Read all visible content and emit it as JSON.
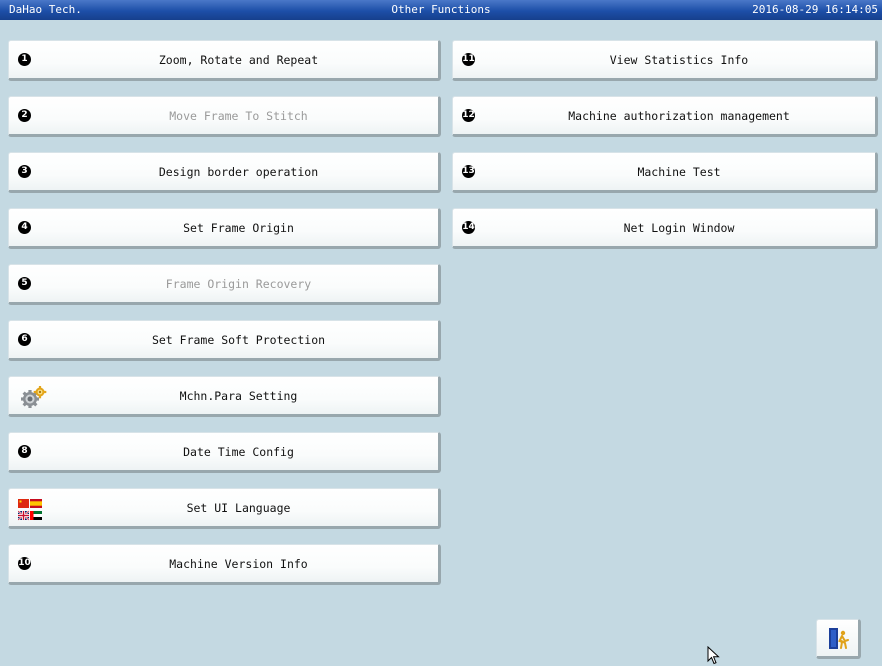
{
  "titlebar": {
    "company": "DaHao Tech.",
    "title": "Other Functions",
    "datetime": "2016-08-29 16:14:05"
  },
  "left_menu": [
    {
      "num": "1",
      "label": "Zoom, Rotate and Repeat",
      "enabled": true,
      "icon": "number-1-icon"
    },
    {
      "num": "2",
      "label": "Move Frame To Stitch",
      "enabled": false,
      "icon": "number-2-icon"
    },
    {
      "num": "3",
      "label": "Design border operation",
      "enabled": true,
      "icon": "number-3-icon"
    },
    {
      "num": "4",
      "label": "Set Frame Origin",
      "enabled": true,
      "icon": "number-4-icon"
    },
    {
      "num": "5",
      "label": "Frame Origin Recovery",
      "enabled": false,
      "icon": "number-5-icon"
    },
    {
      "num": "6",
      "label": "Set Frame Soft Protection",
      "enabled": true,
      "icon": "number-6-icon"
    },
    {
      "num": "",
      "label": "Mchn.Para Setting",
      "enabled": true,
      "icon": "gear-icon"
    },
    {
      "num": "8",
      "label": "Date Time Config",
      "enabled": true,
      "icon": "number-8-icon"
    },
    {
      "num": "",
      "label": "Set UI Language",
      "enabled": true,
      "icon": "language-flags-icon"
    },
    {
      "num": "10",
      "label": "Machine Version Info",
      "enabled": true,
      "icon": "number-10-icon"
    }
  ],
  "right_menu": [
    {
      "num": "11",
      "label": "View Statistics Info",
      "enabled": true,
      "icon": "number-11-icon"
    },
    {
      "num": "12",
      "label": "Machine authorization management",
      "enabled": true,
      "icon": "number-12-icon"
    },
    {
      "num": "13",
      "label": "Machine Test",
      "enabled": true,
      "icon": "number-13-icon"
    },
    {
      "num": "14",
      "label": "Net Login Window",
      "enabled": true,
      "icon": "number-14-icon"
    }
  ],
  "exit_button": {
    "icon": "exit-door-icon"
  },
  "colors": {
    "background": "#c4d9e2",
    "titlebar": "#1d4fa8",
    "disabled_text": "#9a9a9a"
  }
}
